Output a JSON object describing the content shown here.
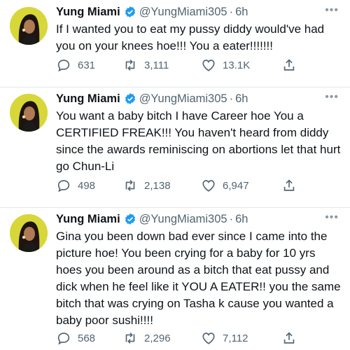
{
  "tweets": [
    {
      "name": "Yung Miami",
      "handle": "@YungMiami305",
      "separator": "·",
      "time": "6h",
      "text": "If I wanted you to eat my pussy diddy would've had you on your knees hoe!!! You a eater!!!!!!!",
      "replies": "631",
      "retweets": "3,111",
      "likes": "13.1K",
      "more_icon": "•••"
    },
    {
      "name": "Yung Miami",
      "handle": "@YungMiami305",
      "separator": "·",
      "time": "6h",
      "text": "You want a baby bitch I have Career hoe You a CERTIFIED FREAK!!! You haven't heard from diddy since the awards reminiscing on abortions let that hurt go Chun-Li",
      "replies": "498",
      "retweets": "2,138",
      "likes": "6,947",
      "more_icon": "•••"
    },
    {
      "name": "Yung Miami",
      "handle": "@YungMiami305",
      "separator": "·",
      "time": "6h",
      "text": "Gina you been down bad ever since I came into the picture hoe! You been crying for a baby for 10 yrs hoes you been around as a bitch that eat pussy and dick when he feel like it YOU A EATER!! you the same bitch that was crying on Tasha k cause you wanted a baby poor sushi!!!!",
      "replies": "568",
      "retweets": "2,296",
      "likes": "7,112",
      "more_icon": "•••"
    }
  ],
  "colors": {
    "verified_blue": "#1d9bf0",
    "secondary_text": "#536471",
    "avatar_background": "#d7d73a",
    "divider": "#e3e7ea"
  },
  "icons": [
    "verified-badge-icon",
    "more-options-icon",
    "reply-icon",
    "retweet-icon",
    "like-icon",
    "share-icon"
  ]
}
